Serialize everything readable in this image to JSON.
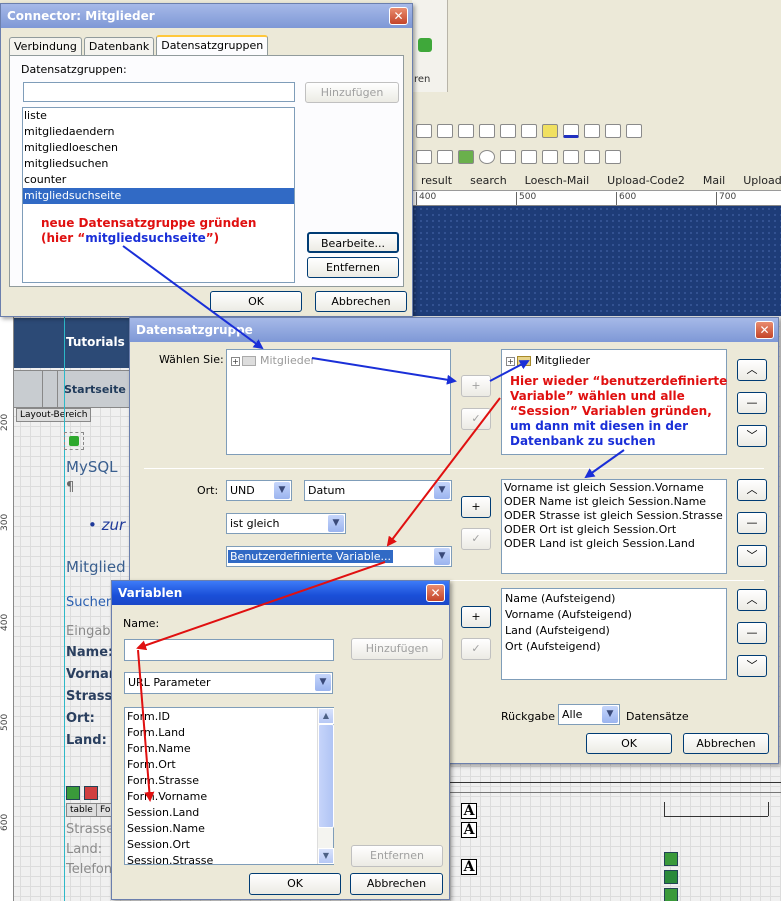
{
  "background": {
    "ribbon_label": "ren",
    "doc_tabs": [
      "result",
      "search",
      "Loesch-Mail",
      "Upload-Code2",
      "Mail",
      "Upload-Code"
    ],
    "ruler_top": [
      "400",
      "500",
      "600",
      "700"
    ],
    "ruler_left": [
      "200",
      "300",
      "400",
      "500",
      "600"
    ],
    "page_header": "Tutorials",
    "nav_item": "Startseite",
    "layout_tag": "Layout-Bereich",
    "page_text": {
      "mysql": "MySQL",
      "pilcrow": "¶",
      "bullet": "• zur",
      "mitglied": "Mitglied",
      "suchen": "Suchen",
      "eingabe": "Eingabe",
      "name": "Name:",
      "vorname": "Vorname",
      "strasse": "Strasse",
      "ort": "Ort:",
      "land": "Land:",
      "strasse2": "Strasse",
      "land2": "Land:",
      "telefon": "Telefon"
    },
    "table_tag": "table",
    "table_tag2": "Fo"
  },
  "connector": {
    "title": "Connector: Mitglieder",
    "tabs": [
      "Verbindung",
      "Datenbank",
      "Datensatzgruppen"
    ],
    "label": "Datensatzgruppen:",
    "input_value": "",
    "add_button": "Hinzufügen",
    "items": [
      "liste",
      "mitgliedaendern",
      "mitgliedloeschen",
      "mitgliedsuchen",
      "counter",
      "mitgliedsuchseite"
    ],
    "selected_index": 5,
    "edit_button": "Bearbeite...",
    "remove_button": "Entfernen",
    "ok_button": "OK",
    "cancel_button": "Abbrechen"
  },
  "recordset": {
    "title": "Datensatzgruppe",
    "choose_label": "Wählen Sie:",
    "left_tree": "Mitglieder",
    "right_tree": "Mitglieder",
    "location_label": "Ort:",
    "op_select": "UND",
    "field_select": "Datum",
    "comparison_select": "ist gleich",
    "variable_select": "Benutzerdefinierte Variable...",
    "conditions": [
      "Vorname ist gleich Session.Vorname",
      "ODER Name ist gleich Session.Name",
      "ODER Strasse ist gleich Session.Strasse",
      "ODER Ort ist gleich Session.Ort",
      "ODER Land ist gleich Session.Land"
    ],
    "sort": [
      "Name (Aufsteigend)",
      "Vorname (Aufsteigend)",
      "Land (Aufsteigend)",
      "Ort (Aufsteigend)"
    ],
    "return_label": "Rückgabe",
    "return_select": "Alle",
    "records_label": "Datensätze",
    "ok_button": "OK",
    "cancel_button": "Abbrechen"
  },
  "variables": {
    "title": "Variablen",
    "name_label": "Name:",
    "name_value": "",
    "add_button": "Hinzufügen",
    "type_select": "URL Parameter",
    "items": [
      "Form.ID",
      "Form.Land",
      "Form.Name",
      "Form.Ort",
      "Form.Strasse",
      "Form.Vorname",
      "Session.Land",
      "Session.Name",
      "Session.Ort",
      "Session.Strasse"
    ],
    "remove_button": "Entfernen",
    "ok_button": "OK",
    "cancel_button": "Abbrechen"
  },
  "annotations": {
    "note1_line1": "neue Datensatzgruppe gründen",
    "note1_line2a": "(hier “",
    "note1_line2b": "mitgliedsuchseite",
    "note1_line2c": "”)",
    "note2_line1": "Hier wieder “benutzerdefinierte",
    "note2_line2": "Variable” wählen und alle",
    "note2_line3": "“Session” Variablen gründen,",
    "note2_line4": "um dann mit diesen in der",
    "note2_line5": "Datenbank zu suchen"
  },
  "colors": {
    "annotation_red": "#e01010",
    "annotation_blue": "#1a2fd8",
    "selection": "#316ac5",
    "titlebar_active": "#1a4fd8"
  }
}
